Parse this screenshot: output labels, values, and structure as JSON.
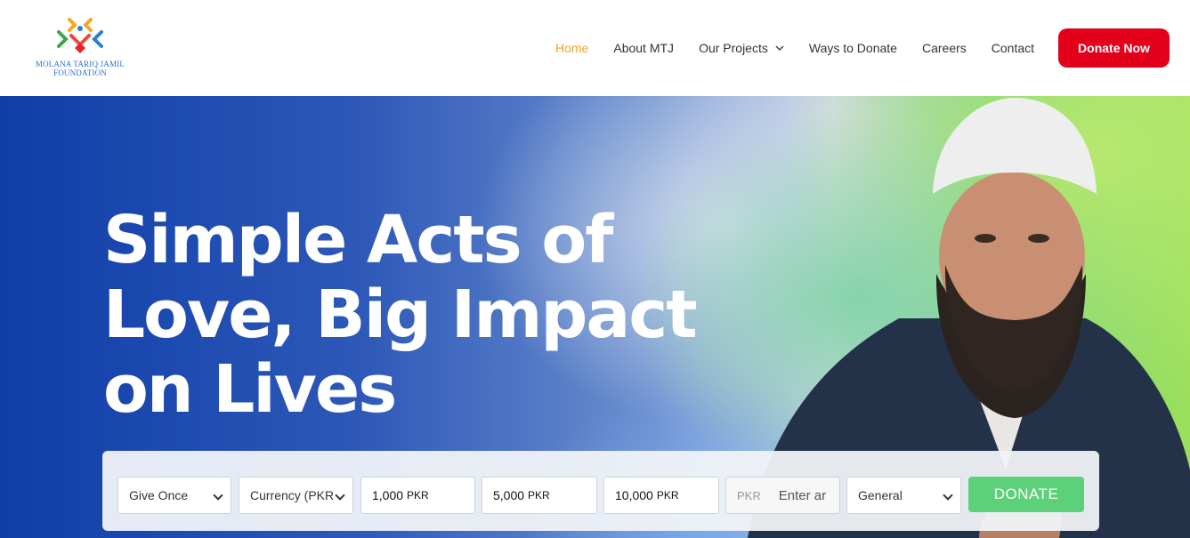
{
  "brand": {
    "logo_text_line1": "MOLANA TARIQ JAMIL",
    "logo_text_line2": "FOUNDATION",
    "logo_icon": "mtj-foundation-logo"
  },
  "nav": {
    "items": [
      {
        "label": "Home",
        "active": true
      },
      {
        "label": "About MTJ",
        "active": false
      },
      {
        "label": "Our Projects",
        "active": false,
        "has_dropdown": true
      },
      {
        "label": "Ways to Donate",
        "active": false
      },
      {
        "label": "Careers",
        "active": false
      },
      {
        "label": "Contact",
        "active": false
      }
    ],
    "cta_label": "Donate Now"
  },
  "hero": {
    "title_line1": "Simple Acts of",
    "title_line2": "Love, Big Impact",
    "title_line3": "on Lives"
  },
  "donation_form": {
    "frequency": "Give Once",
    "currency": "Currency (PKR",
    "amounts": [
      {
        "value": "1,000",
        "currency": "PKR"
      },
      {
        "value": "5,000",
        "currency": "PKR"
      },
      {
        "value": "10,000",
        "currency": "PKR"
      }
    ],
    "custom_prefix": "PKR",
    "custom_placeholder": "Enter ar",
    "fund": "General",
    "submit_label": "DONATE"
  },
  "colors": {
    "accent_orange": "#f0a42a",
    "cta_red": "#e3001b",
    "donate_green": "#5dd17a",
    "hero_blue": "#0f3ea8",
    "hero_green": "#9be05a"
  }
}
